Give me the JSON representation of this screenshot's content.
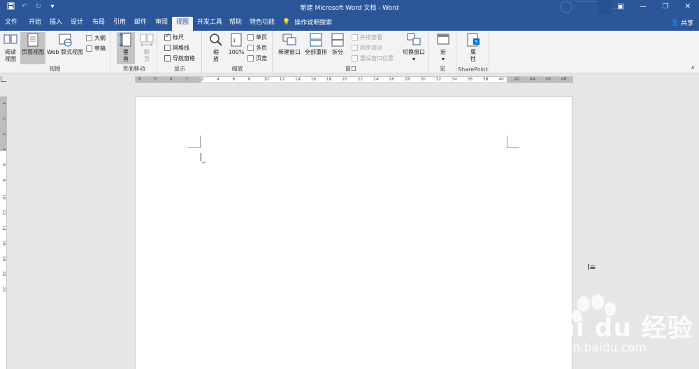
{
  "titlebar": {
    "title": "新建 Microsoft Word 文档 - Word",
    "qat": [
      "save-icon",
      "undo-icon",
      "redo-icon",
      "customize-qat-icon"
    ],
    "controls": [
      "ribbon-display-icon",
      "minimize-icon",
      "restore-icon",
      "close-icon"
    ]
  },
  "tabs": [
    {
      "label": "文件"
    },
    {
      "label": "开始"
    },
    {
      "label": "插入"
    },
    {
      "label": "设计"
    },
    {
      "label": "布局"
    },
    {
      "label": "引用"
    },
    {
      "label": "邮件"
    },
    {
      "label": "审阅"
    },
    {
      "label": "视图",
      "active": true
    },
    {
      "label": "开发工具"
    },
    {
      "label": "帮助"
    },
    {
      "label": "特色功能"
    }
  ],
  "tell_me": "操作说明搜索",
  "share": "共享",
  "ribbon": {
    "views": {
      "name": "视图",
      "read_mode": "阅读\n视图",
      "print_layout": "页面视图",
      "web_layout": "Web 版式视图",
      "outline": "大纲",
      "draft": "草稿"
    },
    "page_movement": {
      "name": "页面移动",
      "vertical": "垂直",
      "side_to_side": "翻页"
    },
    "show": {
      "name": "显示",
      "ruler": "标尺",
      "ruler_checked": true,
      "gridlines": "网格线",
      "gridlines_checked": false,
      "nav_pane": "导航窗格",
      "nav_pane_checked": false
    },
    "zoom": {
      "name": "缩放",
      "zoom": "缩放",
      "percent": "100%",
      "one_page": "单页",
      "multiple_pages": "多页",
      "page_width": "页宽"
    },
    "window": {
      "name": "窗口",
      "new_window": "新建窗口",
      "arrange_all": "全部重排",
      "split": "拆分",
      "side_by_side": "并排查看",
      "sync_scroll": "同步滚动",
      "reset_position": "重设窗口位置",
      "switch_windows": "切换窗口"
    },
    "macros": {
      "name": "宏",
      "macros": "宏"
    },
    "sharepoint": {
      "name": "SharePoint",
      "properties": "属性"
    }
  },
  "ruler_ticks": [
    "8",
    "6",
    "4",
    "2",
    "2",
    "4",
    "6",
    "8",
    "10",
    "12",
    "14",
    "16",
    "18",
    "20",
    "22",
    "24",
    "26",
    "28",
    "30",
    "32",
    "34",
    "36",
    "38",
    "40",
    "42",
    "44",
    "46",
    "48"
  ],
  "vruler_ticks": [
    "4",
    "2",
    "2",
    "4",
    "6",
    "8",
    "10",
    "12",
    "14",
    "16",
    "18",
    "20",
    "22"
  ],
  "watermark": {
    "brand": "Bai du 经验",
    "url": "jingyan.baidu.com"
  },
  "colors": {
    "accent": "#2b579a",
    "ribbon_bg": "#f3f3f3",
    "workspace": "#e6e6e6"
  }
}
